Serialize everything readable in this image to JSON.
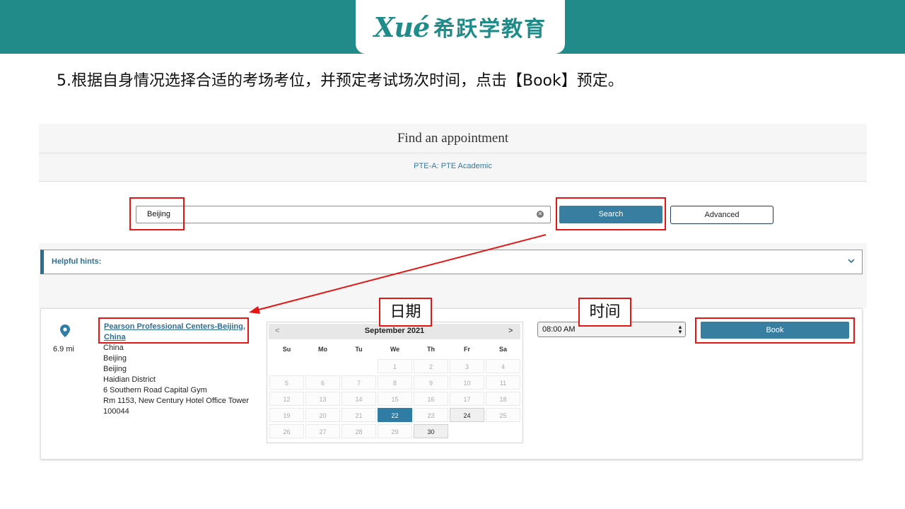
{
  "brand": {
    "logo_latin": "Xué",
    "logo_cn": "希跃学教育",
    "color": "#218b89"
  },
  "instruction": "5.根据自身情况选择合适的考场考位，并预定考试场次时间，点击【Book】预定。",
  "page": {
    "title": "Find an appointment",
    "subtitle": "PTE-A: PTE Academic"
  },
  "search": {
    "value": "Beijing",
    "clear_icon": "clear-icon",
    "search_label": "Search",
    "advanced_label": "Advanced"
  },
  "hints": {
    "label": "Helpful hints:"
  },
  "result": {
    "distance": "6.9  mi",
    "center_name": "Pearson Professional Centers-Beijing, China",
    "address": [
      "China",
      "Beijing",
      "Beijing",
      "Haidian District",
      "6 Southern Road Capital Gym",
      "Rm 1153, New Century Hotel Office Tower",
      "100044"
    ]
  },
  "calendar": {
    "prev": "<",
    "next": ">",
    "month": "September 2021",
    "weekdays": [
      "Su",
      "Mo",
      "Tu",
      "We",
      "Th",
      "Fr",
      "Sa"
    ],
    "weeks": [
      [
        "",
        "",
        "",
        "1",
        "2",
        "3",
        "4"
      ],
      [
        "5",
        "6",
        "7",
        "8",
        "9",
        "10",
        "11"
      ],
      [
        "12",
        "13",
        "14",
        "15",
        "16",
        "17",
        "18"
      ],
      [
        "19",
        "20",
        "21",
        "22",
        "23",
        "24",
        "25"
      ],
      [
        "26",
        "27",
        "28",
        "29",
        "30",
        "",
        ""
      ]
    ],
    "selected": "22",
    "available": [
      "24",
      "30"
    ],
    "accent": "#2f7da5"
  },
  "time": {
    "value": "08:00 AM"
  },
  "book_label": "Book",
  "annotations": {
    "date_label": "日期",
    "time_label": "时间",
    "color": "#e31515"
  }
}
